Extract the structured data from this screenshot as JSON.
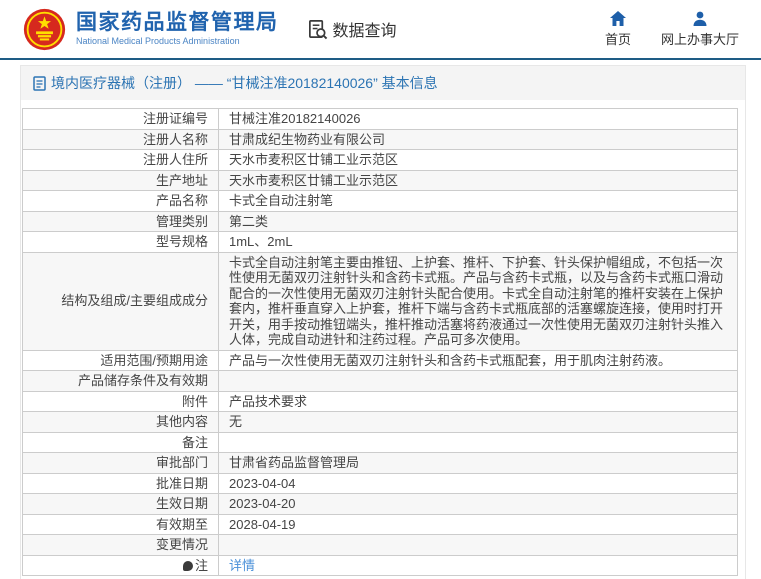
{
  "header": {
    "title_cn": "国家药品监督管理局",
    "title_en": "National Medical Products Administration",
    "data_query_label": "数据查询",
    "nav": [
      {
        "label": "首页",
        "icon": "home-icon"
      },
      {
        "label": "网上办事大厅",
        "icon": "user-icon"
      }
    ]
  },
  "breadcrumb": {
    "icon": "document-icon",
    "text": "境内医疗器械（注册） —— “甘械注准20182140026” 基本信息"
  },
  "colors": {
    "accent_blue": "#2063ae",
    "link_blue": "#4a90d9",
    "header_rule": "#1e5c85",
    "breadcrumb_bg": "#f4f4f4",
    "row_alt_bg": "#f7f7f7",
    "table_border": "#cccccc",
    "emblem_red": "#d6291e",
    "emblem_yellow": "#ffde00"
  },
  "table": {
    "rows": [
      {
        "label": "注册证编号",
        "value": "甘械注准20182140026"
      },
      {
        "label": "注册人名称",
        "value": "甘肃成纪生物药业有限公司"
      },
      {
        "label": "注册人住所",
        "value": "天水市麦积区廿铺工业示范区"
      },
      {
        "label": "生产地址",
        "value": "天水市麦积区廿铺工业示范区"
      },
      {
        "label": "产品名称",
        "value": "卡式全自动注射笔"
      },
      {
        "label": "管理类别",
        "value": "第二类"
      },
      {
        "label": "型号规格",
        "value": "1mL、2mL"
      },
      {
        "label": "结构及组成/主要组成成分",
        "value": "卡式全自动注射笔主要由推钮、上护套、推杆、下护套、针头保护帽组成，不包括一次性使用无菌双刃注射针头和含药卡式瓶。产品与含药卡式瓶，以及与含药卡式瓶口滑动配合的一次性使用无菌双刃注射针头配合使用。卡式全自动注射笔的推杆安装在上保护套内，推杆垂直穿入上护套，推杆下端与含药卡式瓶底部的活塞螺旋连接，使用时打开开关，用手按动推钮端头，推杆推动活塞将药液通过一次性使用无菌双刃注射针头推入人体，完成自动进针和注药过程。产品可多次使用。"
      },
      {
        "label": "适用范围/预期用途",
        "value": "产品与一次性使用无菌双刃注射针头和含药卡式瓶配套，用于肌肉注射药液。"
      },
      {
        "label": "产品储存条件及有效期",
        "value": ""
      },
      {
        "label": "附件",
        "value": "产品技术要求"
      },
      {
        "label": "其他内容",
        "value": "无"
      },
      {
        "label": "备注",
        "value": ""
      },
      {
        "label": "审批部门",
        "value": "甘肃省药品监督管理局"
      },
      {
        "label": "批准日期",
        "value": "2023-04-04"
      },
      {
        "label": "生效日期",
        "value": "2023-04-20"
      },
      {
        "label": "有效期至",
        "value": "2028-04-19"
      },
      {
        "label": "变更情况",
        "value": ""
      },
      {
        "label": "注",
        "value": "详情",
        "link": true,
        "label_icon": "note-icon"
      }
    ]
  }
}
